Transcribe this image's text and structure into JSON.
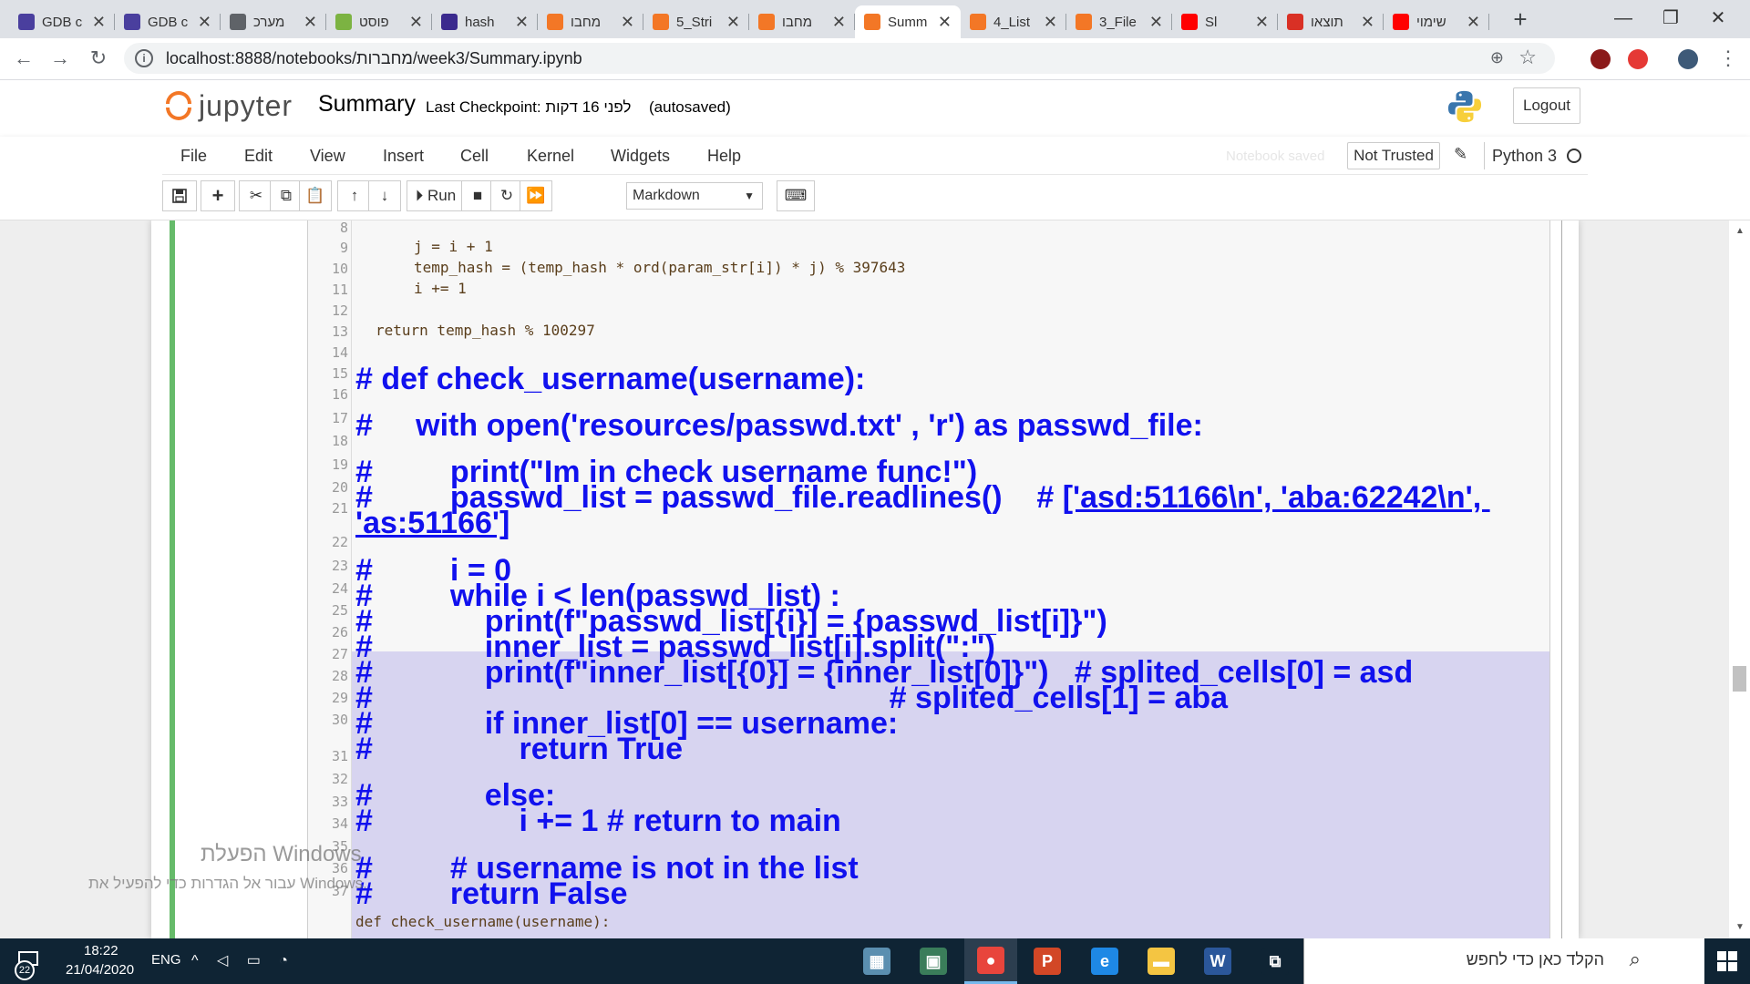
{
  "browser": {
    "tabs": [
      {
        "label": "GDB c",
        "fav": "lightning-icon",
        "color": "#4a3f9e"
      },
      {
        "label": "GDB c",
        "fav": "lightning-icon",
        "color": "#4a3f9e"
      },
      {
        "label": "מערכ",
        "fav": "globe-icon",
        "color": "#5f6368"
      },
      {
        "label": "פוסט",
        "fav": "chrome-web-icon",
        "color": "#7cb342"
      },
      {
        "label": "hash",
        "fav": "plagiarism-icon",
        "color": "#3b2a8e"
      },
      {
        "label": "מחבו",
        "fav": "jupyter-icon",
        "color": "#f37726"
      },
      {
        "label": "5_Stri",
        "fav": "notebook-icon",
        "color": "#f37726"
      },
      {
        "label": "מחבו",
        "fav": "jupyter-icon",
        "color": "#f37726"
      },
      {
        "label": "Summ",
        "fav": "notebook-icon",
        "color": "#f37726",
        "active": true
      },
      {
        "label": "4_List",
        "fav": "notebook-icon",
        "color": "#f37726"
      },
      {
        "label": "3_File",
        "fav": "notebook-icon",
        "color": "#f37726"
      },
      {
        "label": "Sl",
        "fav": "youtube-icon",
        "color": "#ff0000"
      },
      {
        "label": "תוצאו",
        "fav": "gmail-icon",
        "color": "#d93025"
      },
      {
        "label": "שימוי",
        "fav": "youtube-icon",
        "color": "#ff0000"
      }
    ],
    "tab_close": "✕",
    "new_tab": "+",
    "window_controls": {
      "minimize": "—",
      "maximize": "❐",
      "close": "✕"
    },
    "url": "localhost:8888/notebooks/מחברות/week3/Summary.ipynb",
    "nav": {
      "back": "←",
      "forward": "→",
      "reload": "↻"
    }
  },
  "jupyter": {
    "logo_text": "jupyter",
    "notebook_name": "Summary",
    "checkpoint": "Last Checkpoint: לפני 16 דקות",
    "autosaved": "(autosaved)",
    "logout": "Logout",
    "menus": [
      "File",
      "Edit",
      "View",
      "Insert",
      "Cell",
      "Kernel",
      "Widgets",
      "Help"
    ],
    "notebook_status": "Notebook saved",
    "trust": "Not Trusted",
    "kernel_name": "Python 3",
    "run_label": "Run",
    "cell_type": "Markdown",
    "toolbar_icons": [
      "save-icon",
      "add-cell-icon",
      "cut-icon",
      "copy-icon",
      "paste-icon",
      "move-up-icon",
      "move-down-icon",
      "run-icon",
      "stop-icon",
      "restart-icon",
      "fast-forward-icon",
      "keyboard-icon"
    ]
  },
  "code": {
    "line_numbers": [
      "8",
      "9",
      "10",
      "11",
      "12",
      "13",
      "14",
      "15",
      "16",
      "17",
      "18",
      "19",
      "20",
      "21",
      "22",
      "23",
      "24",
      "25",
      "26",
      "27",
      "28",
      "29",
      "30",
      "31",
      "32",
      "33",
      "34",
      "35",
      "36",
      "37"
    ],
    "l9": "j = i + 1",
    "l10": "temp_hash = (temp_hash * ord(param_str[i]) * j) % 397643",
    "l11": "i += 1",
    "l13": "return temp_hash % 100297",
    "l16": "# def check_username(username):",
    "l18": "#     with open('resources/passwd.txt' , 'r') as passwd_file:",
    "l20": "#         print(\"Im in check username func!\")",
    "l21a": "#         passwd_list = passwd_file.readlines()    # ",
    "l21b": "['asd:51166\\n', 'aba:62242\\n', ",
    "l21c": "'as:51166']",
    "l23": "#         i = 0",
    "l24": "#         while i < len(passwd_list) :",
    "l25": "#             print(f\"passwd_list[{i}] = {passwd_list[i]}\")",
    "l26": "#             inner_list = passwd_list[i].split(\":\")",
    "l27": "#             print(f\"inner_list[{0}] = {inner_list[0]}\")   # splited_cells[0] = asd",
    "l28": "#                                                            # splited_cells[1] = aba",
    "l29": "#             if inner_list[0] == username:",
    "l30": "#                 return True",
    "l32": "#             else:",
    "l33": "#                 i += 1 # return to main",
    "l35": "#         # username is not in the list",
    "l36": "#         return False",
    "l37": "def check_username(username):"
  },
  "watermark": {
    "line1": "הפעלת Windows",
    "line2": "עבור אל הגדרות כדי להפעיל את Windows."
  },
  "taskbar": {
    "notifications": "22",
    "time": "18:22",
    "date": "21/04/2020",
    "lang": "ENG",
    "tray": "^ ◁ ▭ ◔",
    "apps": [
      {
        "name": "files-app-icon",
        "label": "▦",
        "color": "#5b8fb0"
      },
      {
        "name": "window-app-icon",
        "label": "▣",
        "color": "#3a7d5a"
      },
      {
        "name": "chrome-icon",
        "label": "●",
        "color": "#e8453c"
      },
      {
        "name": "powerpoint-icon",
        "label": "P",
        "color": "#d24726"
      },
      {
        "name": "edge-icon",
        "label": "e",
        "color": "#1e88e5"
      },
      {
        "name": "explorer-icon",
        "label": "▬",
        "color": "#f4c542"
      },
      {
        "name": "word-icon",
        "label": "W",
        "color": "#2b579a"
      },
      {
        "name": "task-view-icon",
        "label": "⧉",
        "color": "#0f2434"
      }
    ],
    "search_placeholder": "הקלד כאן כדי לחפש",
    "search_icon": "⌕"
  },
  "colors": {
    "jupyter_orange": "#f37726",
    "cell_selected": "#66bb6a",
    "markdown_blue": "#1111ee",
    "selection": "#d7d4f0"
  }
}
